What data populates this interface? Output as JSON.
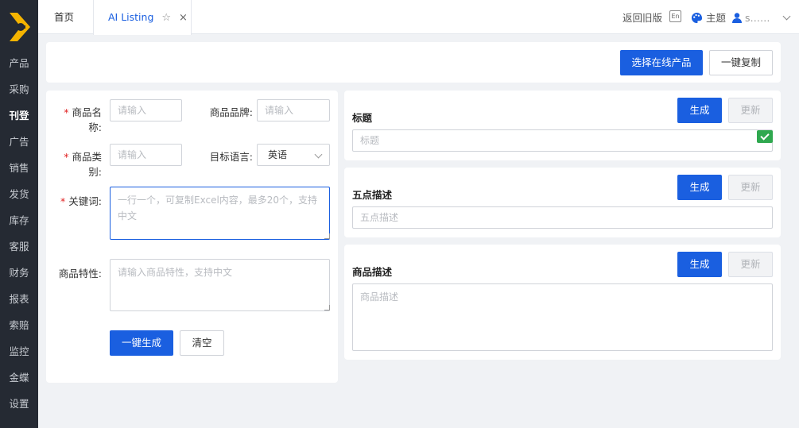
{
  "colors": {
    "sidebar_bg": "#252a33",
    "primary": "#1a5fe0",
    "logo": "#f5b400",
    "success": "#2fa84f"
  },
  "sidebar": {
    "logo_icon": "brand-logo-icon",
    "items": [
      {
        "label": "产品"
      },
      {
        "label": "采购"
      },
      {
        "label": "刊登"
      },
      {
        "label": "广告"
      },
      {
        "label": "销售"
      },
      {
        "label": "发货"
      },
      {
        "label": "库存"
      },
      {
        "label": "客服"
      },
      {
        "label": "财务"
      },
      {
        "label": "报表"
      },
      {
        "label": "索赔"
      },
      {
        "label": "监控"
      },
      {
        "label": "金蝶"
      },
      {
        "label": "设置"
      }
    ],
    "active": "刊登"
  },
  "tabs": {
    "home": "首页",
    "active": "AI Listing",
    "star_icon": "☆",
    "close_icon": "×"
  },
  "header_right": {
    "back_old": "返回旧版",
    "lang_badge": "En",
    "theme": "主题",
    "user": "s……"
  },
  "toolbar": {
    "select_online": "选择在线产品",
    "copy_all": "一键复制"
  },
  "form": {
    "product_name": {
      "label": "商品名称:",
      "placeholder": "请输入"
    },
    "product_brand": {
      "label": "商品品牌:",
      "placeholder": "请输入"
    },
    "product_category": {
      "label": "商品类别:",
      "placeholder": "请输入"
    },
    "target_language": {
      "label": "目标语言:",
      "value": "英语"
    },
    "keywords": {
      "label": "关键词:",
      "placeholder": "一行一个，可复制Excel内容，最多20个，支持中文"
    },
    "features": {
      "label": "商品特性:",
      "placeholder": "请输入商品特性，支持中文"
    },
    "generate_all": "一键生成",
    "clear": "清空"
  },
  "sections": {
    "title": {
      "heading": "标题",
      "placeholder": "标题",
      "generate": "生成",
      "update": "更新"
    },
    "bullets": {
      "heading": "五点描述",
      "placeholder": "五点描述",
      "generate": "生成",
      "update": "更新"
    },
    "description": {
      "heading": "商品描述",
      "placeholder": "商品描述",
      "generate": "生成",
      "update": "更新"
    }
  }
}
